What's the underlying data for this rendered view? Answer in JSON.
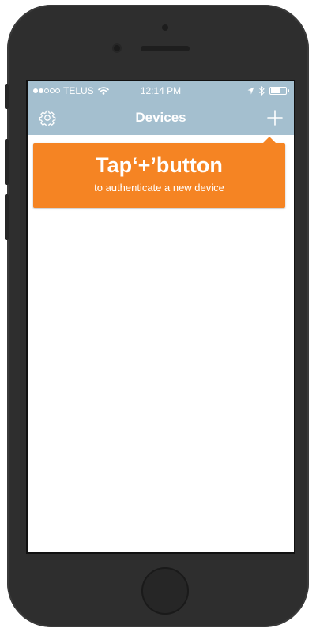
{
  "status_bar": {
    "signal_bars_filled": 2,
    "signal_bars_total": 5,
    "carrier": "TELUS",
    "time": "12:14 PM",
    "battery_level": 0.65
  },
  "nav": {
    "title": "Devices",
    "left_icon": "gear-icon",
    "right_icon": "plus-icon"
  },
  "tooltip": {
    "title": "Tap‘+’button",
    "subtitle": "to authenticate a new device",
    "color": "#f58423"
  },
  "colors": {
    "nav_background": "#a4bfcf",
    "phone_body": "#2e2e2e"
  }
}
